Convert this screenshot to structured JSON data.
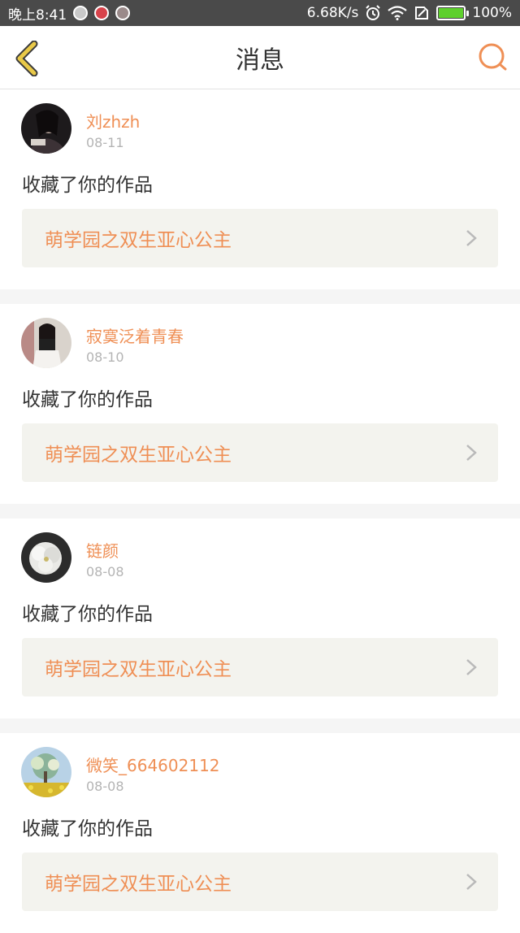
{
  "status_bar": {
    "time": "晚上8:41",
    "speed": "6.68K/s",
    "battery_level": "100%",
    "icons": [
      "alarm-icon",
      "wifi-icon",
      "sim-icon",
      "battery-icon"
    ]
  },
  "app_bar": {
    "title": "消息",
    "back_icon": "chevron-left-icon",
    "search_icon": "search-icon"
  },
  "colors": {
    "accent": "#ef8f55",
    "back_icon": "#e9c948",
    "card_bg": "#f3f3ee"
  },
  "messages": [
    {
      "user": "刘zhzh",
      "date": "08-11",
      "action": "收藏了你的作品",
      "work_title": "萌学园之双生亚心公主"
    },
    {
      "user": "寂寞泛着青春",
      "date": "08-10",
      "action": "收藏了你的作品",
      "work_title": "萌学园之双生亚心公主"
    },
    {
      "user": "链颜",
      "date": "08-08",
      "action": "收藏了你的作品",
      "work_title": "萌学园之双生亚心公主"
    },
    {
      "user": "微笑_664602112",
      "date": "08-08",
      "action": "收藏了你的作品",
      "work_title": "萌学园之双生亚心公主"
    }
  ]
}
